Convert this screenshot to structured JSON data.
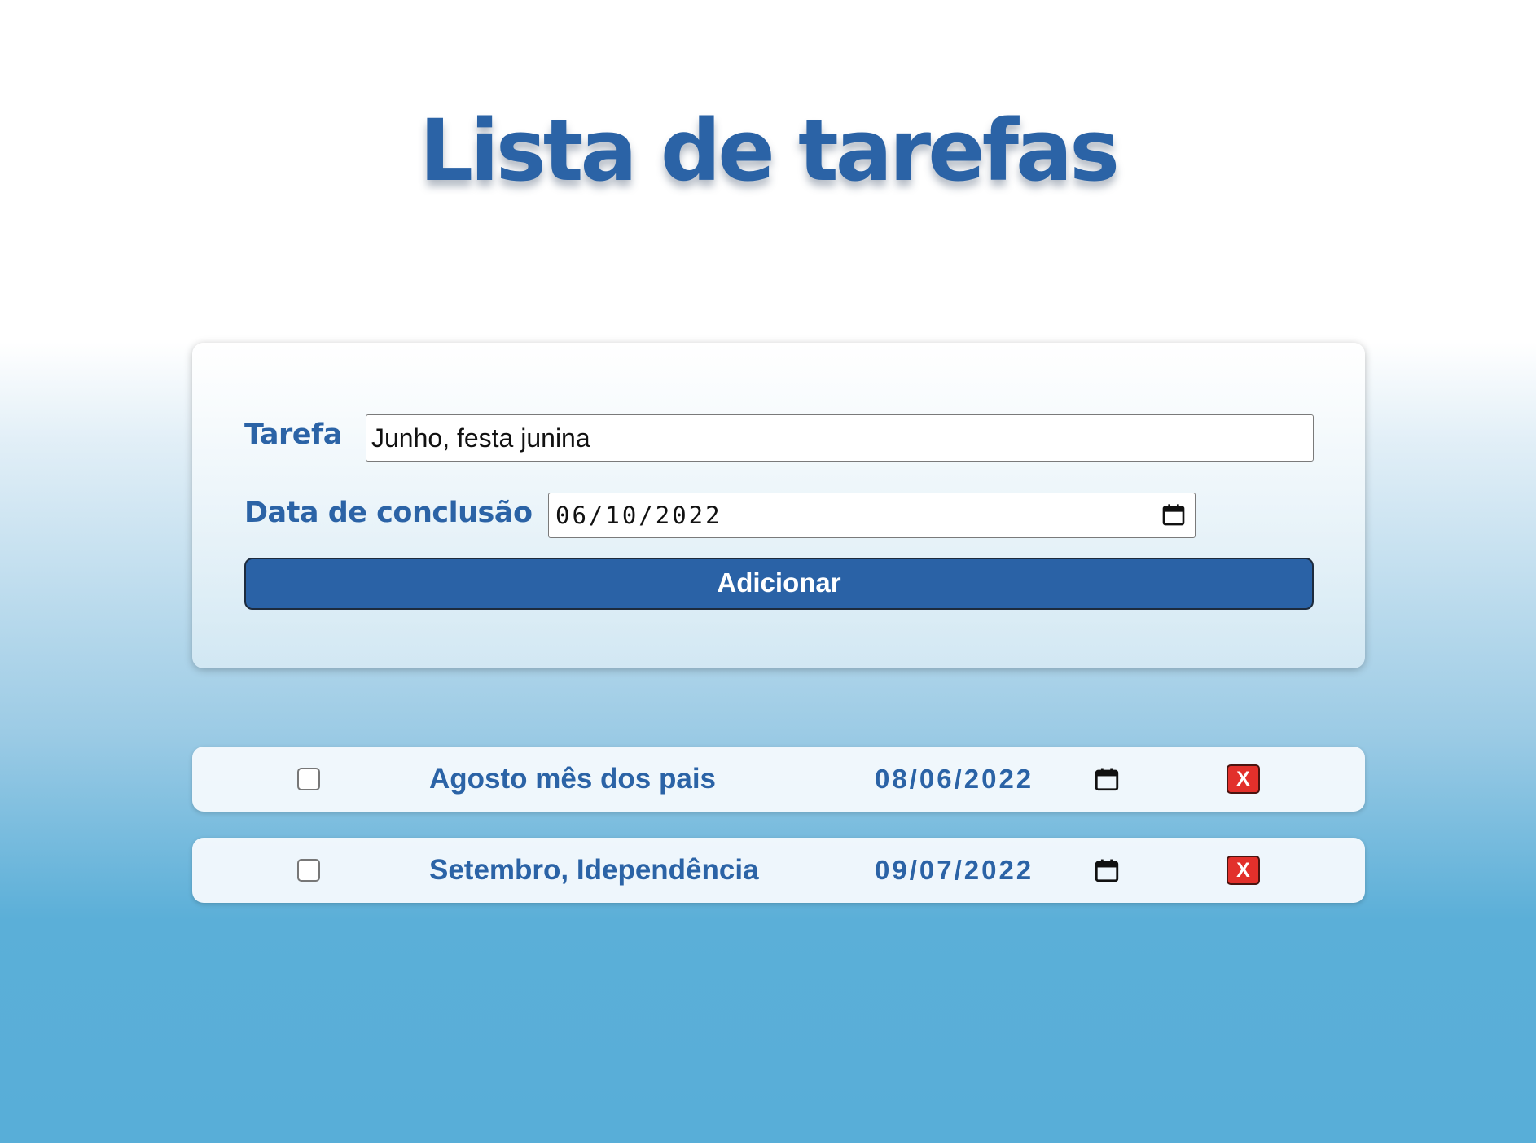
{
  "page": {
    "title": "Lista de tarefas"
  },
  "form": {
    "task_label": "Tarefa",
    "task_value": "Junho, festa junina",
    "date_label": "Data de conclusão",
    "date_value": "06/10/2022",
    "date_icon": "calendar-icon",
    "add_button_label": "Adicionar"
  },
  "tasks": [
    {
      "name": "Agosto mês dos pais",
      "date": "08/06/2022",
      "checked": false,
      "delete_label": "X"
    },
    {
      "name": "Setembro, Idependência",
      "date": "09/07/2022",
      "checked": false,
      "delete_label": "X"
    }
  ],
  "colors": {
    "accent_blue": "#2b63a6",
    "button_blue": "#2a62a6",
    "delete_red": "#e2302b",
    "background_bottom": "#58aed8"
  }
}
